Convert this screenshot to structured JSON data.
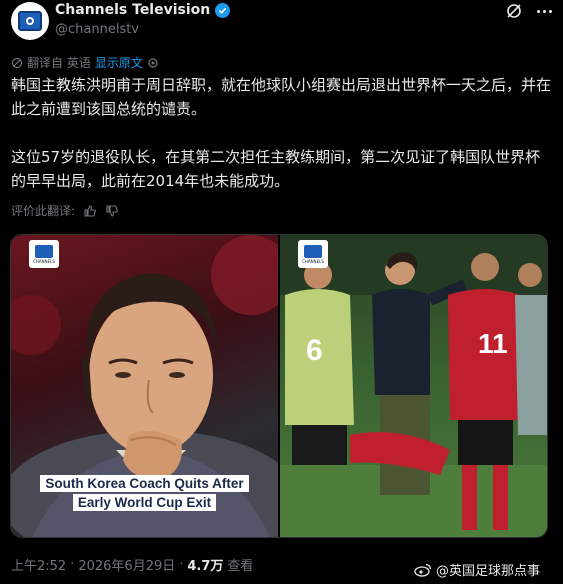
{
  "header": {
    "account_name": "Channels Television",
    "handle": "@channelstv"
  },
  "translation": {
    "label": "翻译自 英语",
    "show_original": "显示原文"
  },
  "post": {
    "paragraph_1": "韩国主教练洪明甫于周日辞职，就在他球队小组赛出局退出世界杯一天之后，并在此之前遭到该国总统的谴责。",
    "paragraph_2": "这位57岁的退役队长，在其第二次担任主教练期间，第二次见证了韩国队世界杯的早早出局，此前在2014年也未能成功。"
  },
  "rate": {
    "label": "评价此翻译:"
  },
  "media": {
    "logo_text": "CHANNELS",
    "headline_line_1": "South Korea Coach Quits After",
    "headline_line_2": "Early World Cup Exit",
    "jersey_number": "11",
    "bib_number": "6"
  },
  "footer": {
    "time": "上午2:52",
    "date": "2026年6月29日",
    "views_count": "4.7万",
    "views_label": "查看"
  },
  "watermark": {
    "text": "@英国足球那点事"
  },
  "colors": {
    "background": "#000000",
    "accent": "#1d9bf0",
    "muted": "#71767b",
    "text": "#e7e9ea"
  }
}
